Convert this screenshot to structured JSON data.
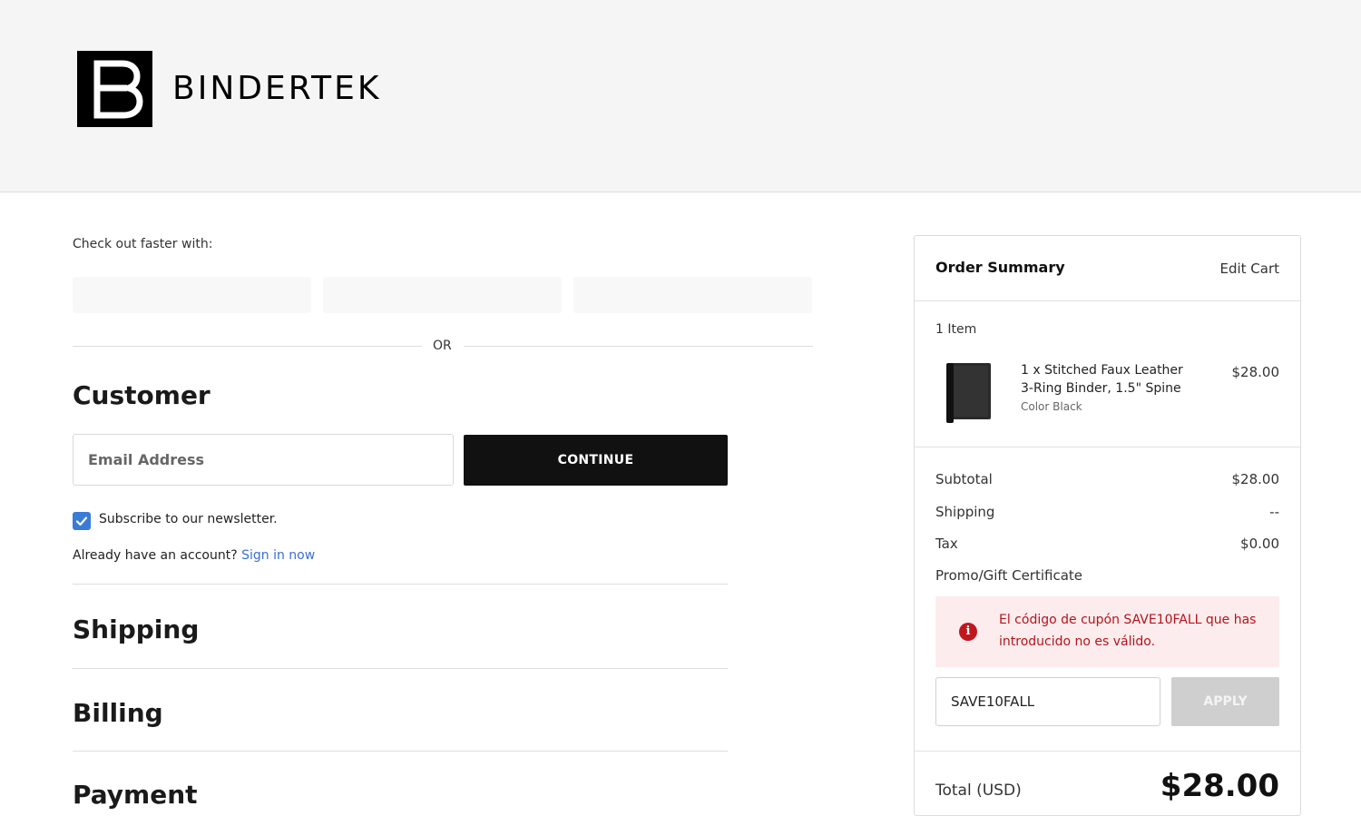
{
  "brand": {
    "name": "BINDERTEK",
    "logo_letter": "B"
  },
  "checkout": {
    "fast_label": "Check out faster with:",
    "or_label": "OR"
  },
  "customer": {
    "title": "Customer",
    "email_placeholder": "Email Address",
    "continue_label": "CONTINUE",
    "newsletter_label": "Subscribe to our newsletter.",
    "newsletter_checked": true,
    "account_prompt": "Already have an account?",
    "sign_in_label": "Sign in now"
  },
  "sections": {
    "shipping": "Shipping",
    "billing": "Billing",
    "payment": "Payment"
  },
  "summary": {
    "title": "Order Summary",
    "edit_cart_label": "Edit Cart",
    "item_count": "1 Item",
    "item": {
      "name_line1": "1 x Stitched Faux Leather",
      "name_line2": "3-Ring Binder, 1.5\" Spine",
      "option": "Color Black",
      "price": "$28.00"
    },
    "subtotal_label": "Subtotal",
    "subtotal_value": "$28.00",
    "shipping_label": "Shipping",
    "shipping_value": "--",
    "tax_label": "Tax",
    "tax_value": "$0.00",
    "promo_label": "Promo/Gift Certificate",
    "error_message": "El código de cupón SAVE10FALL que has introducido no es válido.",
    "promo_value": "SAVE10FALL",
    "apply_label": "APPLY",
    "total_label": "Total (USD)",
    "total_value": "$28.00"
  },
  "colors": {
    "link": "#3b6fd4",
    "error": "#b3141c",
    "error_bg": "#fdeced",
    "accent_checkbox": "#3a7bd5"
  }
}
